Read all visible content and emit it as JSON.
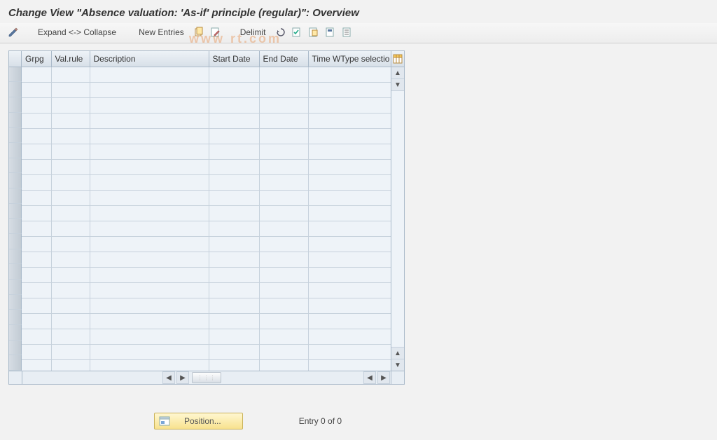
{
  "title": "Change View \"Absence valuation: 'As-if' principle (regular)\": Overview",
  "toolbar": {
    "expand_collapse": "Expand <-> Collapse",
    "new_entries": "New Entries",
    "delimit": "Delimit"
  },
  "columns": {
    "grpg": "Grpg",
    "valrule": "Val.rule",
    "description": "Description",
    "start_date": "Start Date",
    "end_date": "End Date",
    "time_wtype": "Time WType selectio"
  },
  "footer": {
    "position_label": "Position...",
    "entry_text": "Entry 0 of 0"
  },
  "watermark": "www             rt.com"
}
